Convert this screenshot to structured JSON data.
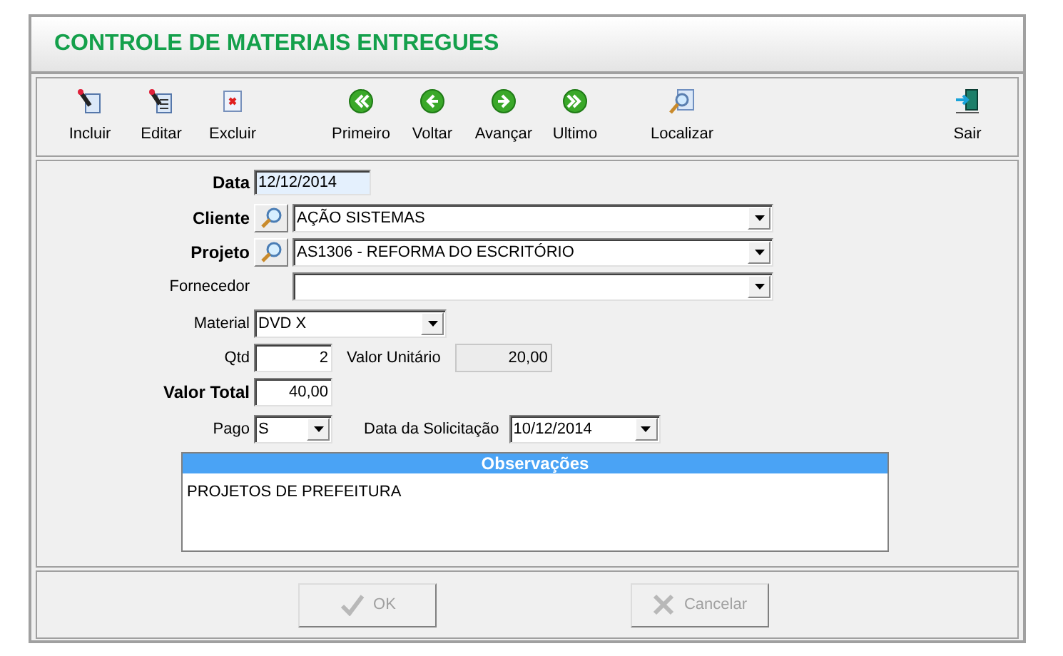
{
  "window": {
    "title": "CONTROLE DE MATERIAIS ENTREGUES"
  },
  "toolbar": [
    {
      "label": "Incluir",
      "kind": "add"
    },
    {
      "label": "Editar",
      "kind": "edit"
    },
    {
      "label": "Excluir",
      "kind": "delete"
    },
    {
      "label": "Primeiro",
      "kind": "first"
    },
    {
      "label": "Voltar",
      "kind": "previous"
    },
    {
      "label": "Avançar",
      "kind": "next"
    },
    {
      "label": "Ultimo",
      "kind": "last"
    },
    {
      "label": "Localizar",
      "kind": "search"
    },
    {
      "label": "Sair",
      "kind": "exit"
    }
  ],
  "form": {
    "data": {
      "label": "Data",
      "value": "12/12/2014"
    },
    "cliente": {
      "label": "Cliente",
      "value": "AÇÃO SISTEMAS"
    },
    "projeto": {
      "label": "Projeto",
      "value": "AS1306 - REFORMA DO ESCRITÓRIO"
    },
    "fornecedor": {
      "label": "Fornecedor"
    },
    "material": {
      "label": "Material",
      "value": "DVD X"
    },
    "qtd": {
      "label": "Qtd",
      "value": "2"
    },
    "valor_unitario": {
      "label": "Valor Unitário",
      "value": "20,00"
    },
    "valor_total": {
      "label": "Valor Total",
      "value": "40,00"
    },
    "pago": {
      "label": "Pago",
      "value": "S"
    },
    "data_solicitacao": {
      "label": "Data da Solicitação",
      "value": "10/12/2014"
    },
    "observacoes": {
      "title": "Observações",
      "value": "PROJETOS DE PREFEITURA"
    }
  },
  "buttons": [
    {
      "label": "OK",
      "kind": "ok",
      "disabled": true
    },
    {
      "label": "Cancelar",
      "kind": "cancel",
      "disabled": true
    }
  ]
}
